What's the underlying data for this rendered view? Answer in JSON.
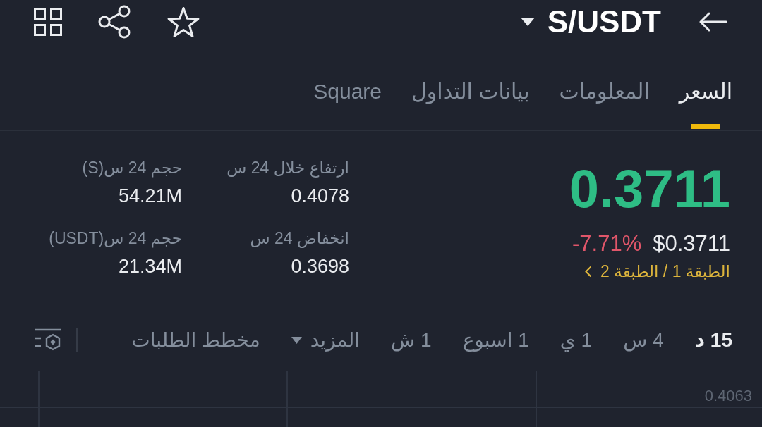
{
  "header": {
    "pair": "S/USDT"
  },
  "tabs": [
    {
      "label": "السعر",
      "selected": true
    },
    {
      "label": "المعلومات",
      "selected": false
    },
    {
      "label": "بيانات التداول",
      "selected": false
    },
    {
      "label": "Square",
      "selected": false
    }
  ],
  "ticker": {
    "last_price": {
      "text": "0.3711",
      "positive": true
    },
    "price_usd": "$0.3711",
    "change": {
      "text": "-7.71%",
      "positive": false
    },
    "tags": "الطبقة 1 / الطبقة 2"
  },
  "stats": [
    {
      "label": "ارتفاع خلال 24 س",
      "value": "0.4078"
    },
    {
      "label": "حجم 24 س(S)",
      "value": "54.21M"
    },
    {
      "label": "انخفاض 24 س",
      "value": "0.3698"
    },
    {
      "label": "حجم 24 س(USDT)",
      "value": "21.34M"
    }
  ],
  "intervals": [
    {
      "label": "15 د",
      "selected": true
    },
    {
      "label": "4 س",
      "selected": false
    },
    {
      "label": "1 ي",
      "selected": false
    },
    {
      "label": "1 اسبوع",
      "selected": false
    },
    {
      "label": "1 ش",
      "selected": false
    }
  ],
  "more_menu": {
    "label": "المزيد"
  },
  "depth_chart_tab": {
    "label": "مخطط الطلبات"
  },
  "chart": {
    "axis_label": "0.4063"
  }
}
